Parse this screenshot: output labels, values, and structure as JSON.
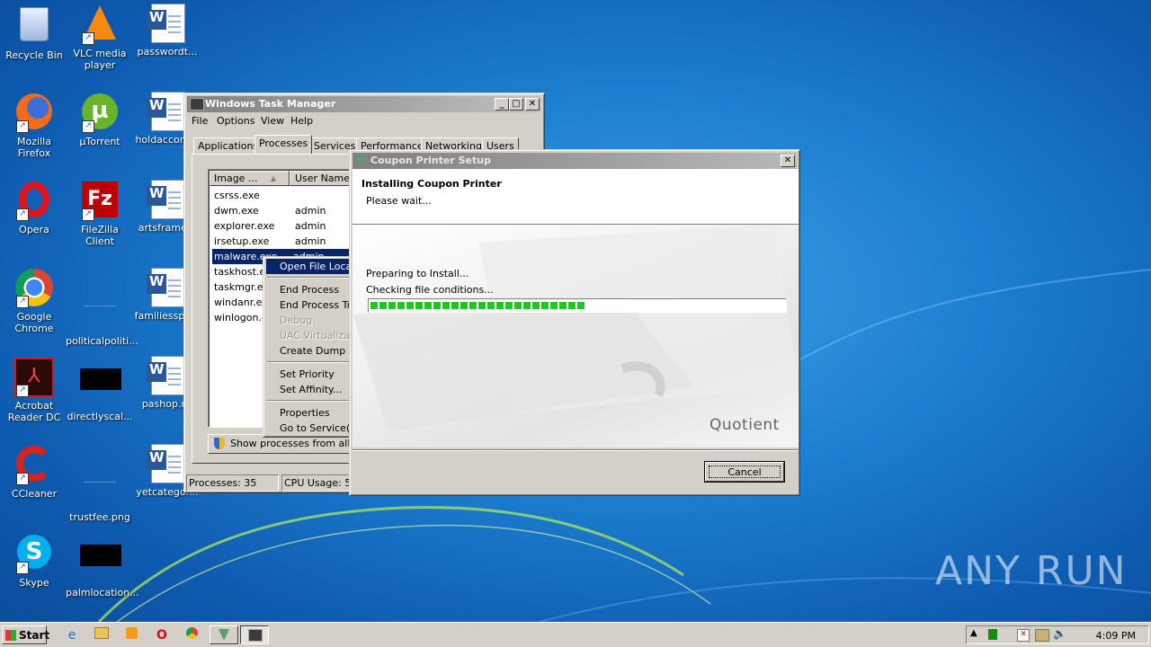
{
  "desktop_icons": [
    {
      "label": "Recycle Bin",
      "icon": "recycle-bin-icon"
    },
    {
      "label": "VLC media player",
      "icon": "vlc-icon"
    },
    {
      "label": "passwordt...",
      "icon": "word-doc-icon"
    },
    {
      "label": "Mozilla Firefox",
      "icon": "firefox-icon"
    },
    {
      "label": "µTorrent",
      "icon": "utorrent-icon"
    },
    {
      "label": "holdaccord...",
      "icon": "word-doc-icon"
    },
    {
      "label": "Opera",
      "icon": "opera-icon"
    },
    {
      "label": "FileZilla Client",
      "icon": "filezilla-icon"
    },
    {
      "label": "artsframe...",
      "icon": "word-doc-icon"
    },
    {
      "label": "Google Chrome",
      "icon": "chrome-icon"
    },
    {
      "label": "politicalpoliti...",
      "icon": "blank-file-icon"
    },
    {
      "label": "familiesspo...",
      "icon": "word-doc-icon"
    },
    {
      "label": "Acrobat Reader DC",
      "icon": "acrobat-icon"
    },
    {
      "label": "directlyscal...",
      "icon": "black-thumbnail-icon"
    },
    {
      "label": "pashop.rtf",
      "icon": "word-doc-icon"
    },
    {
      "label": "CCleaner",
      "icon": "ccleaner-icon"
    },
    {
      "label": "trustfee.png",
      "icon": "blank-file-icon"
    },
    {
      "label": "yetcategor...",
      "icon": "word-doc-icon"
    },
    {
      "label": "Skype",
      "icon": "skype-icon"
    },
    {
      "label": "palmlocation...",
      "icon": "black-thumbnail-icon"
    }
  ],
  "taskmgr": {
    "title": "Windows Task Manager",
    "menu": [
      "File",
      "Options",
      "View",
      "Help"
    ],
    "tabs": [
      "Applications",
      "Processes",
      "Services",
      "Performance",
      "Networking",
      "Users"
    ],
    "columns": [
      "Image ...",
      "User Name"
    ],
    "rows": [
      {
        "image": "csrss.exe",
        "user": ""
      },
      {
        "image": "dwm.exe",
        "user": "admin"
      },
      {
        "image": "explorer.exe",
        "user": "admin"
      },
      {
        "image": "irsetup.exe",
        "user": "admin"
      },
      {
        "image": "malware.exe",
        "user": "admin"
      },
      {
        "image": "taskhost.ex",
        "user": ""
      },
      {
        "image": "taskmgr.ex",
        "user": ""
      },
      {
        "image": "windanr.ex",
        "user": ""
      },
      {
        "image": "winlogon.ex",
        "user": ""
      }
    ],
    "show_all": "Show processes from all users",
    "status_processes": "Processes: 35",
    "status_cpu": "CPU Usage: 5%"
  },
  "context_menu": {
    "items": [
      {
        "label": "Open File Location",
        "state": "highlight"
      },
      {
        "label": "End Process",
        "state": "normal"
      },
      {
        "label": "End Process Tree",
        "state": "normal"
      },
      {
        "label": "Debug",
        "state": "disabled"
      },
      {
        "label": "UAC Virtualization",
        "state": "disabled"
      },
      {
        "label": "Create Dump File",
        "state": "normal"
      },
      {
        "label": "Set Priority",
        "state": "normal"
      },
      {
        "label": "Set Affinity...",
        "state": "normal"
      },
      {
        "label": "Properties",
        "state": "normal"
      },
      {
        "label": "Go to Service(s)",
        "state": "normal"
      }
    ]
  },
  "setup": {
    "title": "Coupon Printer Setup",
    "heading": "Installing Coupon Printer",
    "subheading": "Please wait...",
    "status1": "Preparing to Install...",
    "status2": "Checking file conditions...",
    "progress": 0.52,
    "brand": "Quotient",
    "cancel": "Cancel"
  },
  "taskbar": {
    "start": "Start",
    "clock": "4:09 PM"
  },
  "watermark": "ANY RUN",
  "colors": {
    "title_active": "#0a246a",
    "progress": "#22c322",
    "desktop": "#1c7ed0"
  }
}
